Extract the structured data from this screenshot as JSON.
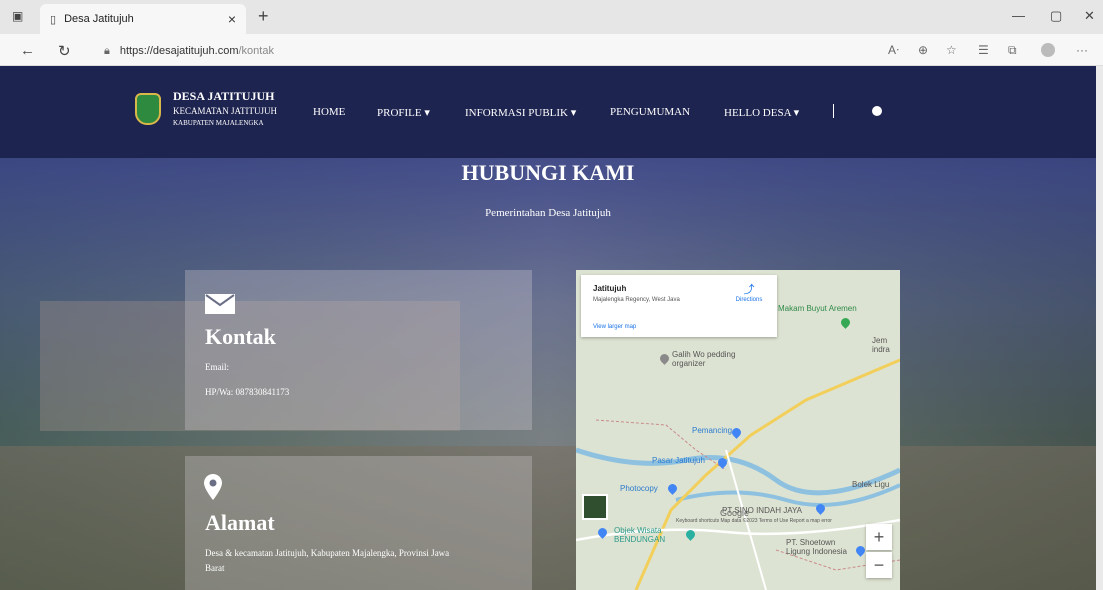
{
  "browser": {
    "tab_title": "Desa Jatitujuh",
    "tab_close": "×",
    "new_tab": "+",
    "url_host": "https://desajatitujuh.com",
    "url_path": "/kontak",
    "window_controls": {
      "minimize": "—",
      "restore": "▢",
      "close": "✕"
    }
  },
  "navbar": {
    "brand_line1": "DESA JATITUJUH",
    "brand_line2": "KECAMATAN JATITUJUH",
    "brand_line3": "KABUPATEN MAJALENGKA",
    "menu": [
      "HOME",
      "PROFILE ▾",
      "INFORMASI PUBLIK ▾",
      "PENGUMUMAN",
      "HELLO DESA ▾"
    ]
  },
  "hero": {
    "title": "HUBUNGI KAMI",
    "subtitle": "Pemerintahan Desa Jatitujuh"
  },
  "contact_card": {
    "icon": "envelope-icon",
    "heading": "Kontak",
    "email_label": "Email:",
    "phone": "HP/Wa: 087830841173"
  },
  "address_card": {
    "icon": "map-pin-icon",
    "heading": "Alamat",
    "address_line1": "Desa & kecamatan Jatitujuh, Kabupaten Majalengka, Provinsi Jawa",
    "address_line2": "Barat"
  },
  "map": {
    "info_title": "Jatitujuh",
    "info_address": "Majalengka Regency, West Java",
    "info_link": "View larger map",
    "directions_label": "Directions",
    "places": [
      "Makam Buyut Aremen",
      "Galih Wo pedding organizer",
      "Pemancing",
      "Pasar Jatitujuh",
      "Photocopy",
      "PT SINO INDAH JAYA",
      "Objek Wisata BENDUNGAN",
      "PT. Shoetown Ligung Indonesia",
      "Bolek Ligu",
      "Jem indra"
    ],
    "zoom_in": "+",
    "zoom_out": "−",
    "google": "Google",
    "footer": "Keyboard shortcuts   Map data ©2023   Terms of Use   Report a map error"
  },
  "colors": {
    "navbar_bg": "#1e2450",
    "map_road_yellow": "#f2cf5b",
    "map_water": "#8ec1e0",
    "map_pin_red": "#ea4335",
    "map_pin_blue": "#4285f4",
    "map_pin_green": "#34a853"
  }
}
